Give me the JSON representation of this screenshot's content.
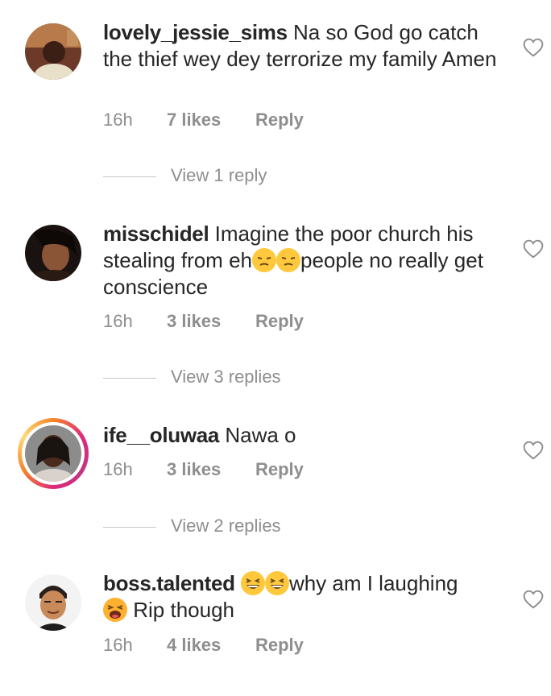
{
  "comments": [
    {
      "username": "lovely_jessie_sims",
      "text": "Na so God go catch the thief wey dey terrorize my family Amen",
      "time": "16h",
      "likes": "7 likes",
      "reply": "Reply",
      "view_replies": "View 1 reply"
    },
    {
      "username": "misschidel",
      "text_before": "Imagine the poor church his stealing from eh",
      "text_after": "people no really get conscience",
      "emojis": [
        "unamused-face",
        "unamused-face"
      ],
      "time": "16h",
      "likes": "3 likes",
      "reply": "Reply",
      "view_replies": "View 3 replies"
    },
    {
      "username": "ife__oluwaa",
      "text": "Nawa o",
      "time": "16h",
      "likes": "3 likes",
      "reply": "Reply",
      "view_replies": "View 2 replies"
    },
    {
      "username": "boss.talented",
      "emojis_before": [
        "grinning-squinting-face",
        "grinning-squinting-face"
      ],
      "text_before": "why am I laughing",
      "emojis_after": [
        "tired-face"
      ],
      "text_after": "Rip though",
      "time": "16h",
      "likes": "4 likes",
      "reply": "Reply"
    }
  ],
  "colors": {
    "text": "#262626",
    "secondary": "#8e8e8e",
    "divider": "#c7c7c7",
    "story_ring_start": "#f58529",
    "story_ring_end": "#dd2a7b"
  }
}
